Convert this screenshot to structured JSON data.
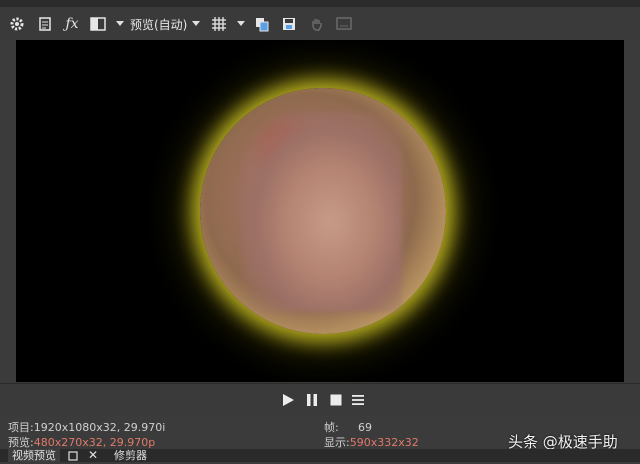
{
  "toolbar": {
    "preview_quality": "预览(自动)",
    "icons": [
      "gear-icon",
      "properties-icon",
      "fx-icon",
      "split-screen-icon",
      "grid-icon",
      "copy-snapshot-icon",
      "save-snapshot-icon",
      "hand-icon",
      "external-monitor-icon"
    ]
  },
  "viewer": {
    "background": "#000000",
    "glow_color": "#e8dc3a"
  },
  "transport": {
    "icons": [
      "play-icon",
      "pause-icon",
      "stop-icon",
      "menu-icon"
    ]
  },
  "info": {
    "project_label": "项目:",
    "project_value": "1920x1080x32, 29.970i",
    "preview_label": "预览:",
    "preview_value": "480x270x32, 29.970p",
    "frame_label": "帧:",
    "frame_value": "69",
    "display_label": "显示:",
    "display_value": "590x332x32",
    "highlight_color": "#e07a6a"
  },
  "watermark": "头条 @极速手助",
  "tabs": {
    "video_preview": "视频预览",
    "trimmer": "修剪器"
  }
}
